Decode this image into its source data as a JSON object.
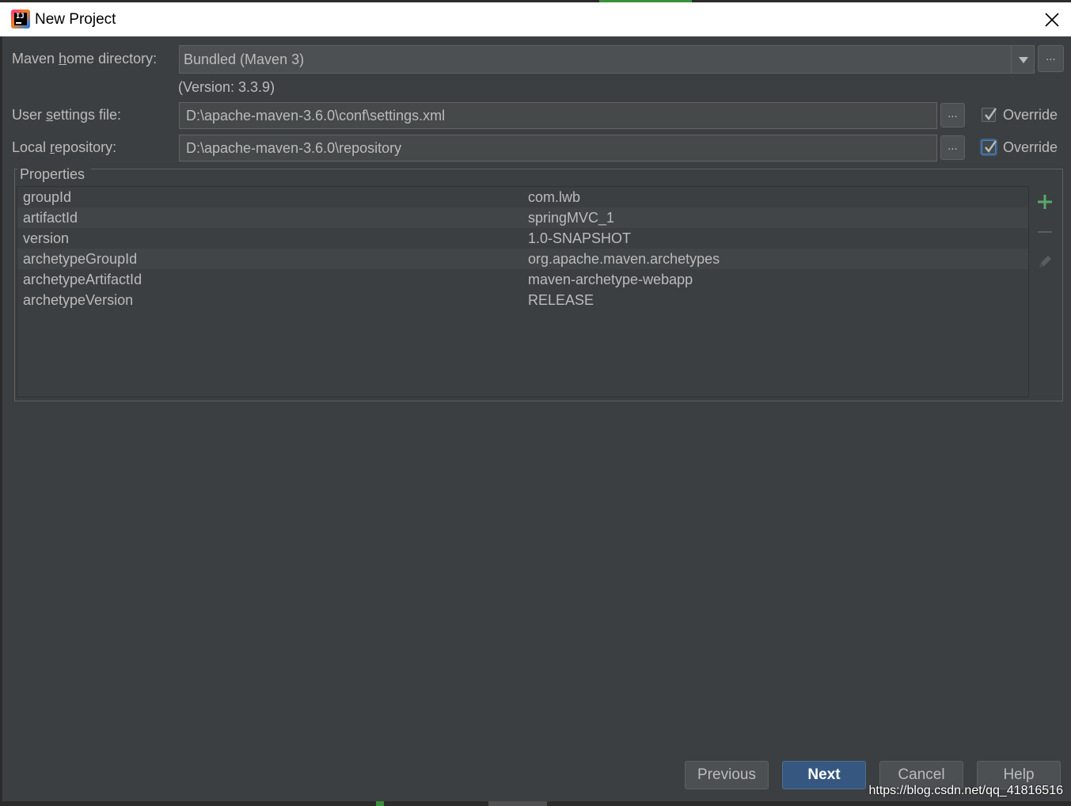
{
  "window": {
    "title": "New Project",
    "app_icon": "intellij-idea-icon",
    "close_icon": "close-icon"
  },
  "maven_home": {
    "label_prefix": "Maven ",
    "label_mnemonic": "h",
    "label_suffix": "ome directory:",
    "value": "Bundled (Maven 3)",
    "version_note": "(Version: 3.3.9)",
    "browse_label": "..."
  },
  "user_settings": {
    "label_prefix": "User ",
    "label_mnemonic": "s",
    "label_suffix": "ettings file:",
    "value": "D:\\apache-maven-3.6.0\\conf\\settings.xml",
    "browse_label": "...",
    "override_label": "Override",
    "override_checked": true
  },
  "local_repository": {
    "label_prefix": "Local ",
    "label_mnemonic": "r",
    "label_suffix": "epository:",
    "value": "D:\\apache-maven-3.6.0\\repository",
    "browse_label": "...",
    "override_label": "Override",
    "override_checked": true
  },
  "properties": {
    "legend": "Properties",
    "rows": [
      {
        "key": "groupId",
        "value": "com.lwb"
      },
      {
        "key": "artifactId",
        "value": "springMVC_1"
      },
      {
        "key": "version",
        "value": "1.0-SNAPSHOT"
      },
      {
        "key": "archetypeGroupId",
        "value": "org.apache.maven.archetypes"
      },
      {
        "key": "archetypeArtifactId",
        "value": "maven-archetype-webapp"
      },
      {
        "key": "archetypeVersion",
        "value": "RELEASE"
      }
    ],
    "tools": [
      "add-icon",
      "remove-icon",
      "edit-icon"
    ]
  },
  "buttons": {
    "previous": "Previous",
    "next": "Next",
    "cancel": "Cancel",
    "help": "Help"
  },
  "watermark": "https://blog.csdn.net/qq_41816516",
  "colors": {
    "background": "#3c3f41",
    "field": "#45494a",
    "default_button": "#365880",
    "add_icon": "#59a869",
    "text": "#bbbbbb"
  }
}
